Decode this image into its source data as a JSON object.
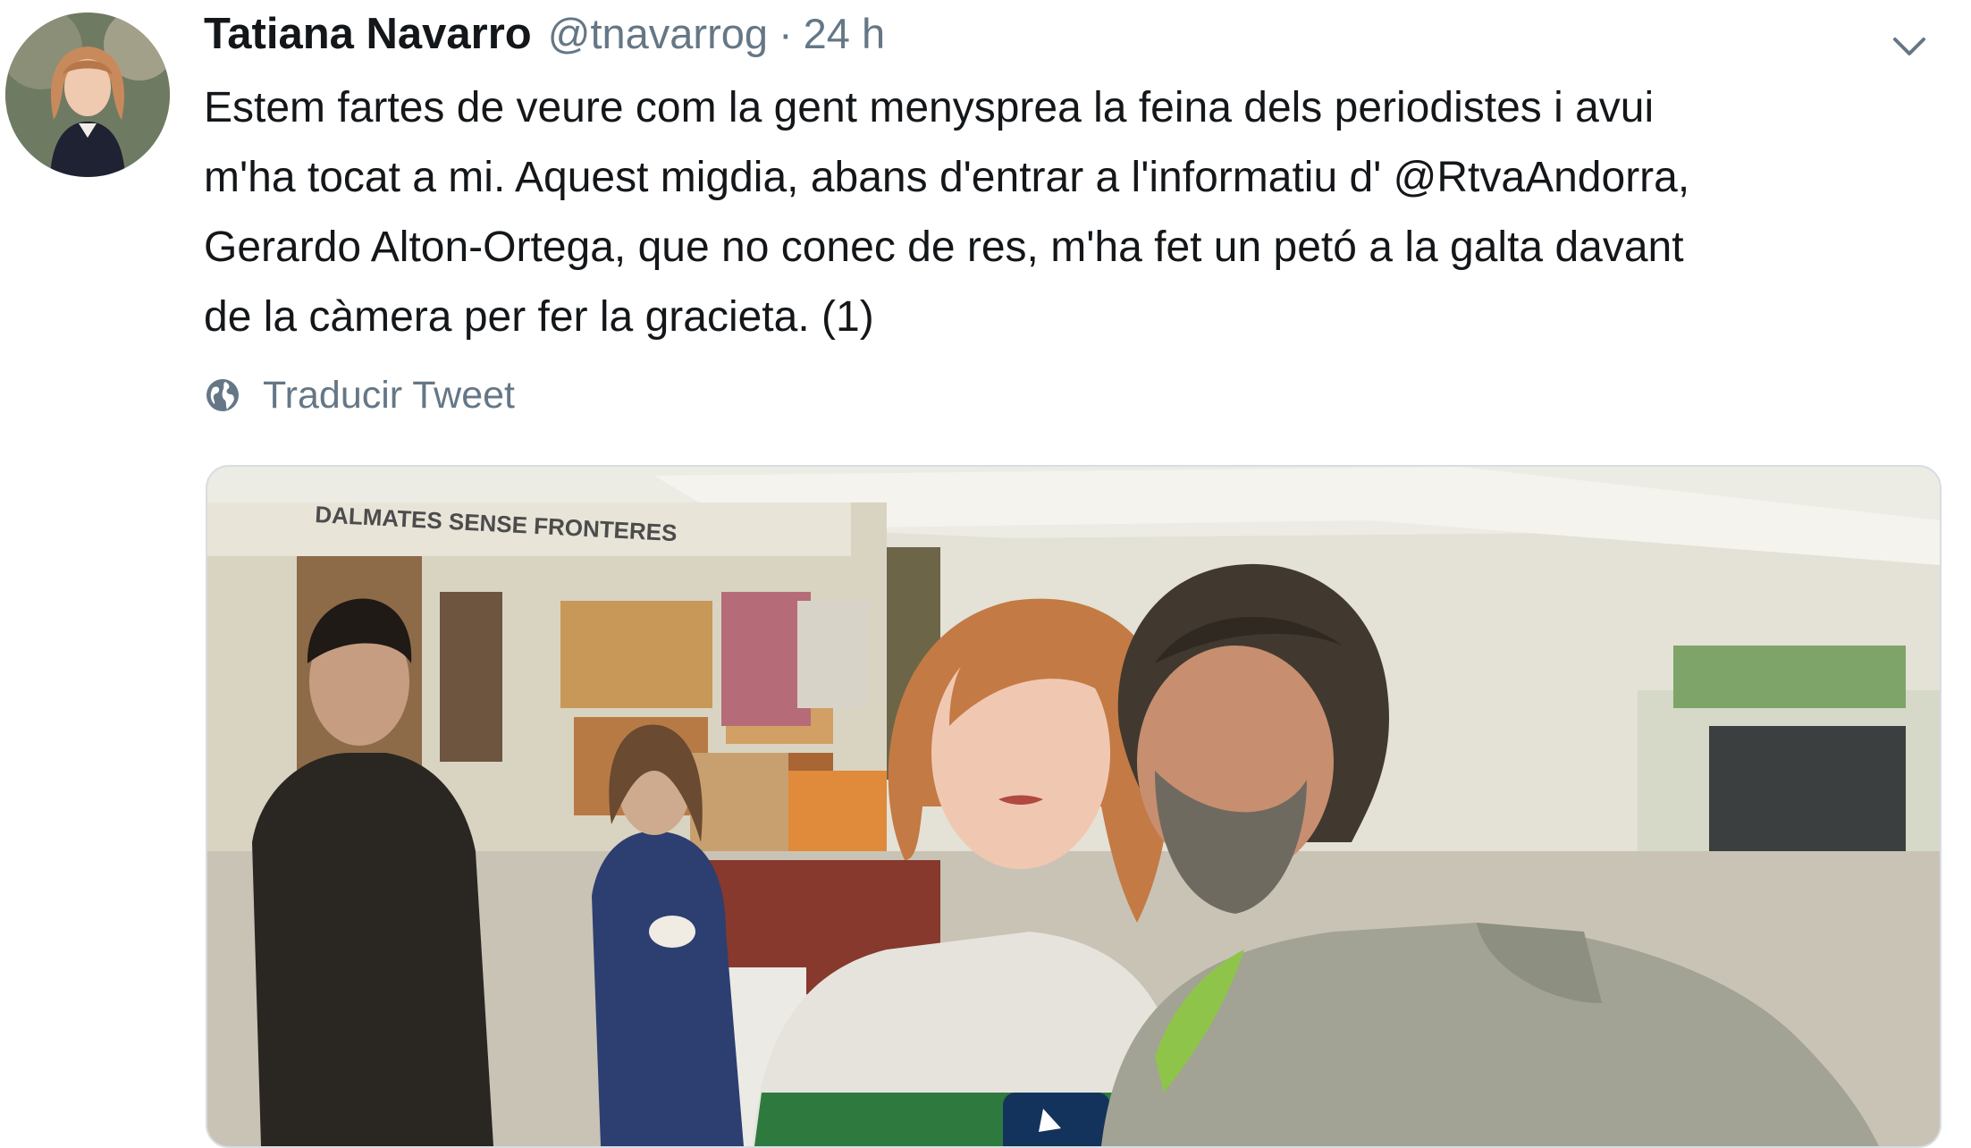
{
  "tweet": {
    "author": {
      "display_name": "Tatiana Navarro",
      "handle": "@tnavarrog",
      "avatar_icon": "user-avatar"
    },
    "separator": "·",
    "time": "24 h",
    "menu_icon": "chevron-down-icon",
    "text_lines": [
      "Estem fartes de veure com la gent menysprea la feina dels periodistes i avui",
      "m'ha tocat a mi. Aquest migdia, abans d'entrar a l'informatiu d' @RtvaAndorra,",
      "Gerardo Alton-Ortega, que no conec de res, m'ha fet un petó a la galta davant",
      "de la càmera per fer la gracieta. (1)"
    ],
    "translate_label": "Traducir Tweet",
    "translate_icon": "globe-icon",
    "media": {
      "sign_text": "DALMATES SENSE FRONTERES"
    }
  },
  "colors": {
    "text_primary": "#14171a",
    "text_secondary": "#657786",
    "border": "#d7dde2"
  }
}
